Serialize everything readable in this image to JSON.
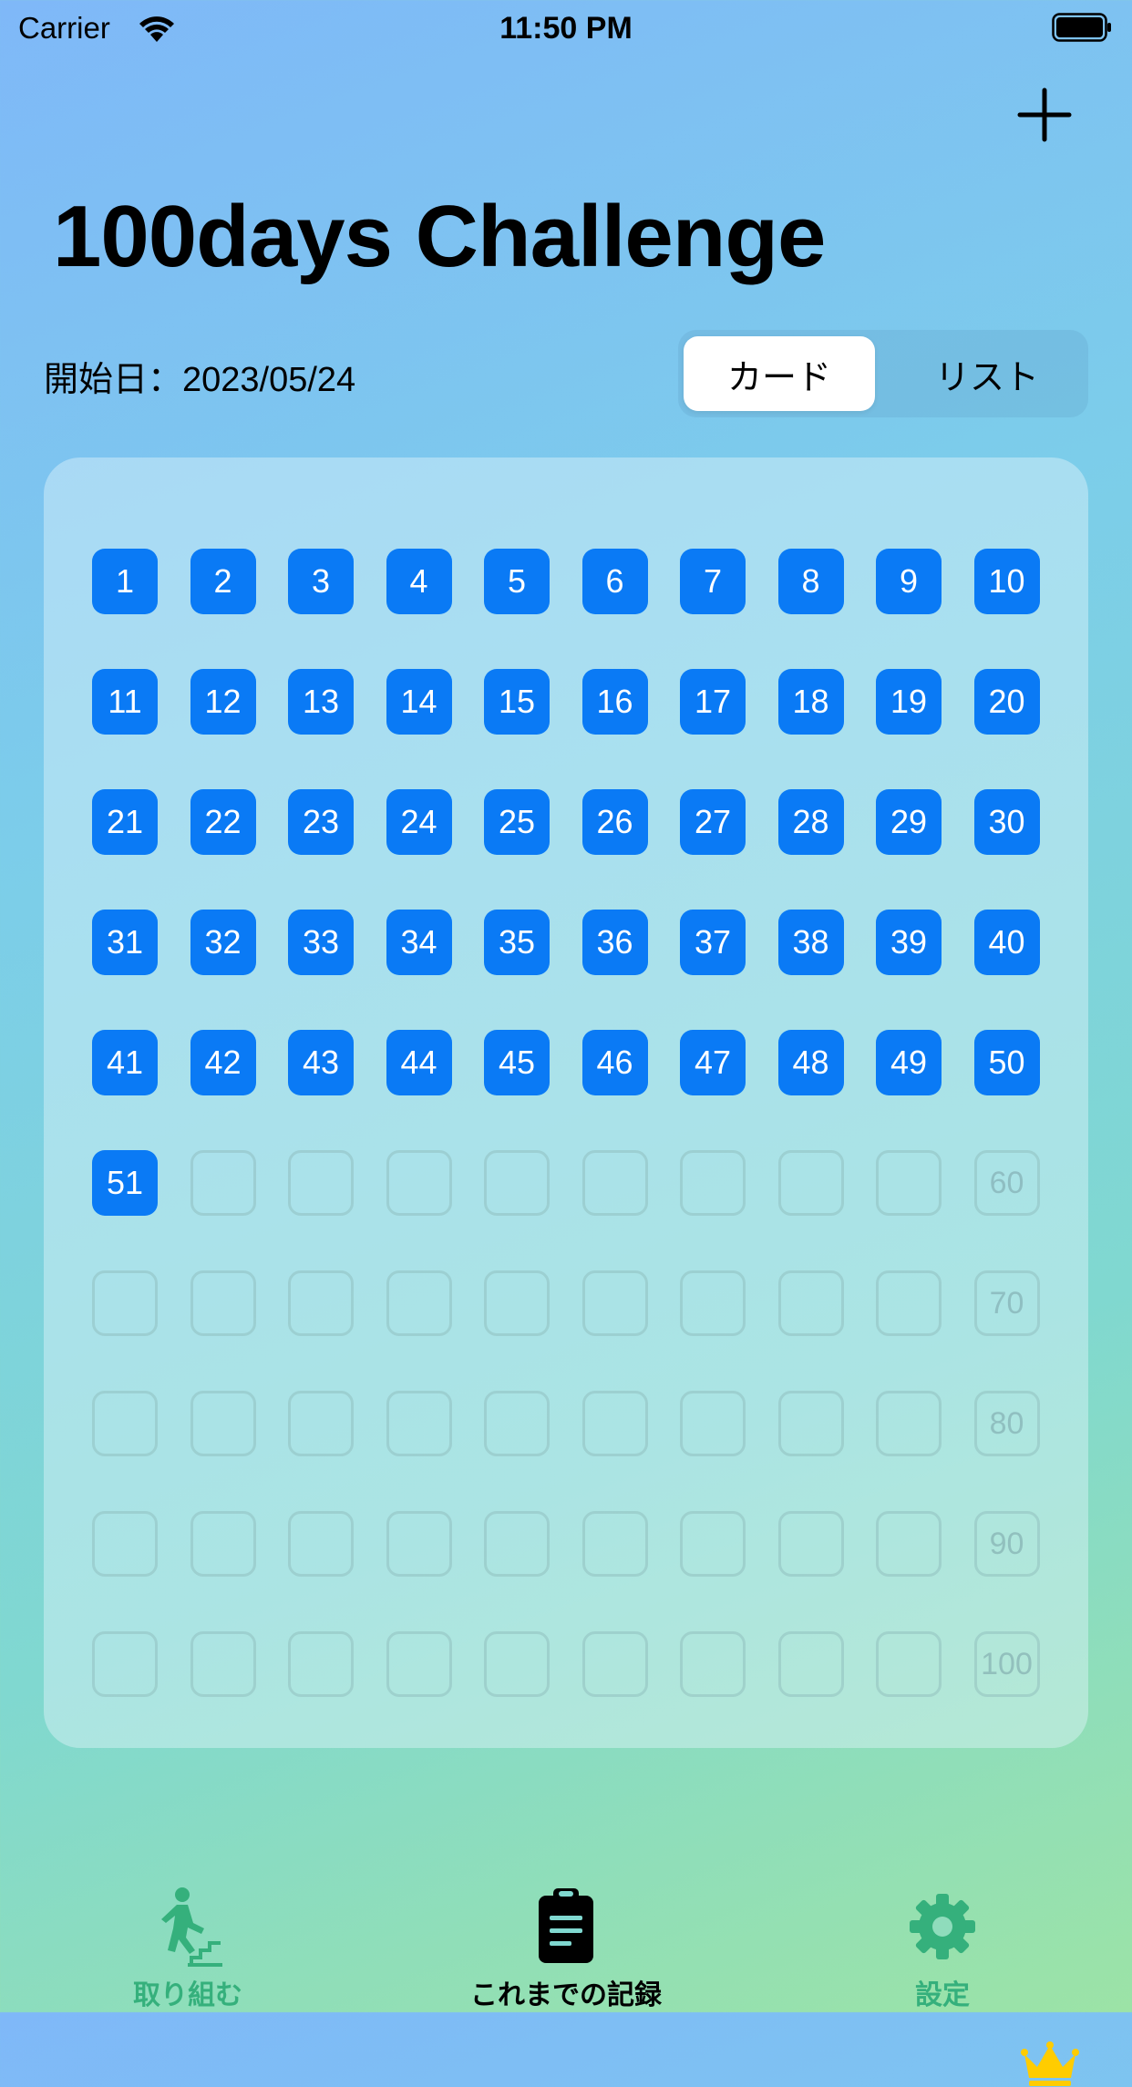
{
  "status_bar": {
    "carrier": "Carrier",
    "time": "11:50 PM"
  },
  "header": {
    "title": "100days Challenge",
    "add_icon": "plus-icon"
  },
  "start_date": {
    "text": "開始日：2023/05/24"
  },
  "view_switch": {
    "options": [
      "カード",
      "リスト"
    ],
    "selected": "カード"
  },
  "grid": {
    "total_days": 100,
    "completed_days": 51,
    "columns": 10,
    "milestone_labels": [
      "60",
      "70",
      "80",
      "90",
      "100"
    ],
    "goal_icon": "crown-icon"
  },
  "tab_bar": {
    "tabs": [
      {
        "label": "取り組む",
        "icon": "stairs-climbing-icon",
        "color": "#35b07c"
      },
      {
        "label": "これまでの記録",
        "icon": "clipboard-icon",
        "color": "#000000"
      },
      {
        "label": "設定",
        "icon": "gear-icon",
        "color": "#35b07c"
      }
    ],
    "selected": "これまでの記録"
  },
  "colors": {
    "accent": "#0a7af5",
    "crown": "#ffcc00",
    "tab_inactive": "#35b07c"
  }
}
